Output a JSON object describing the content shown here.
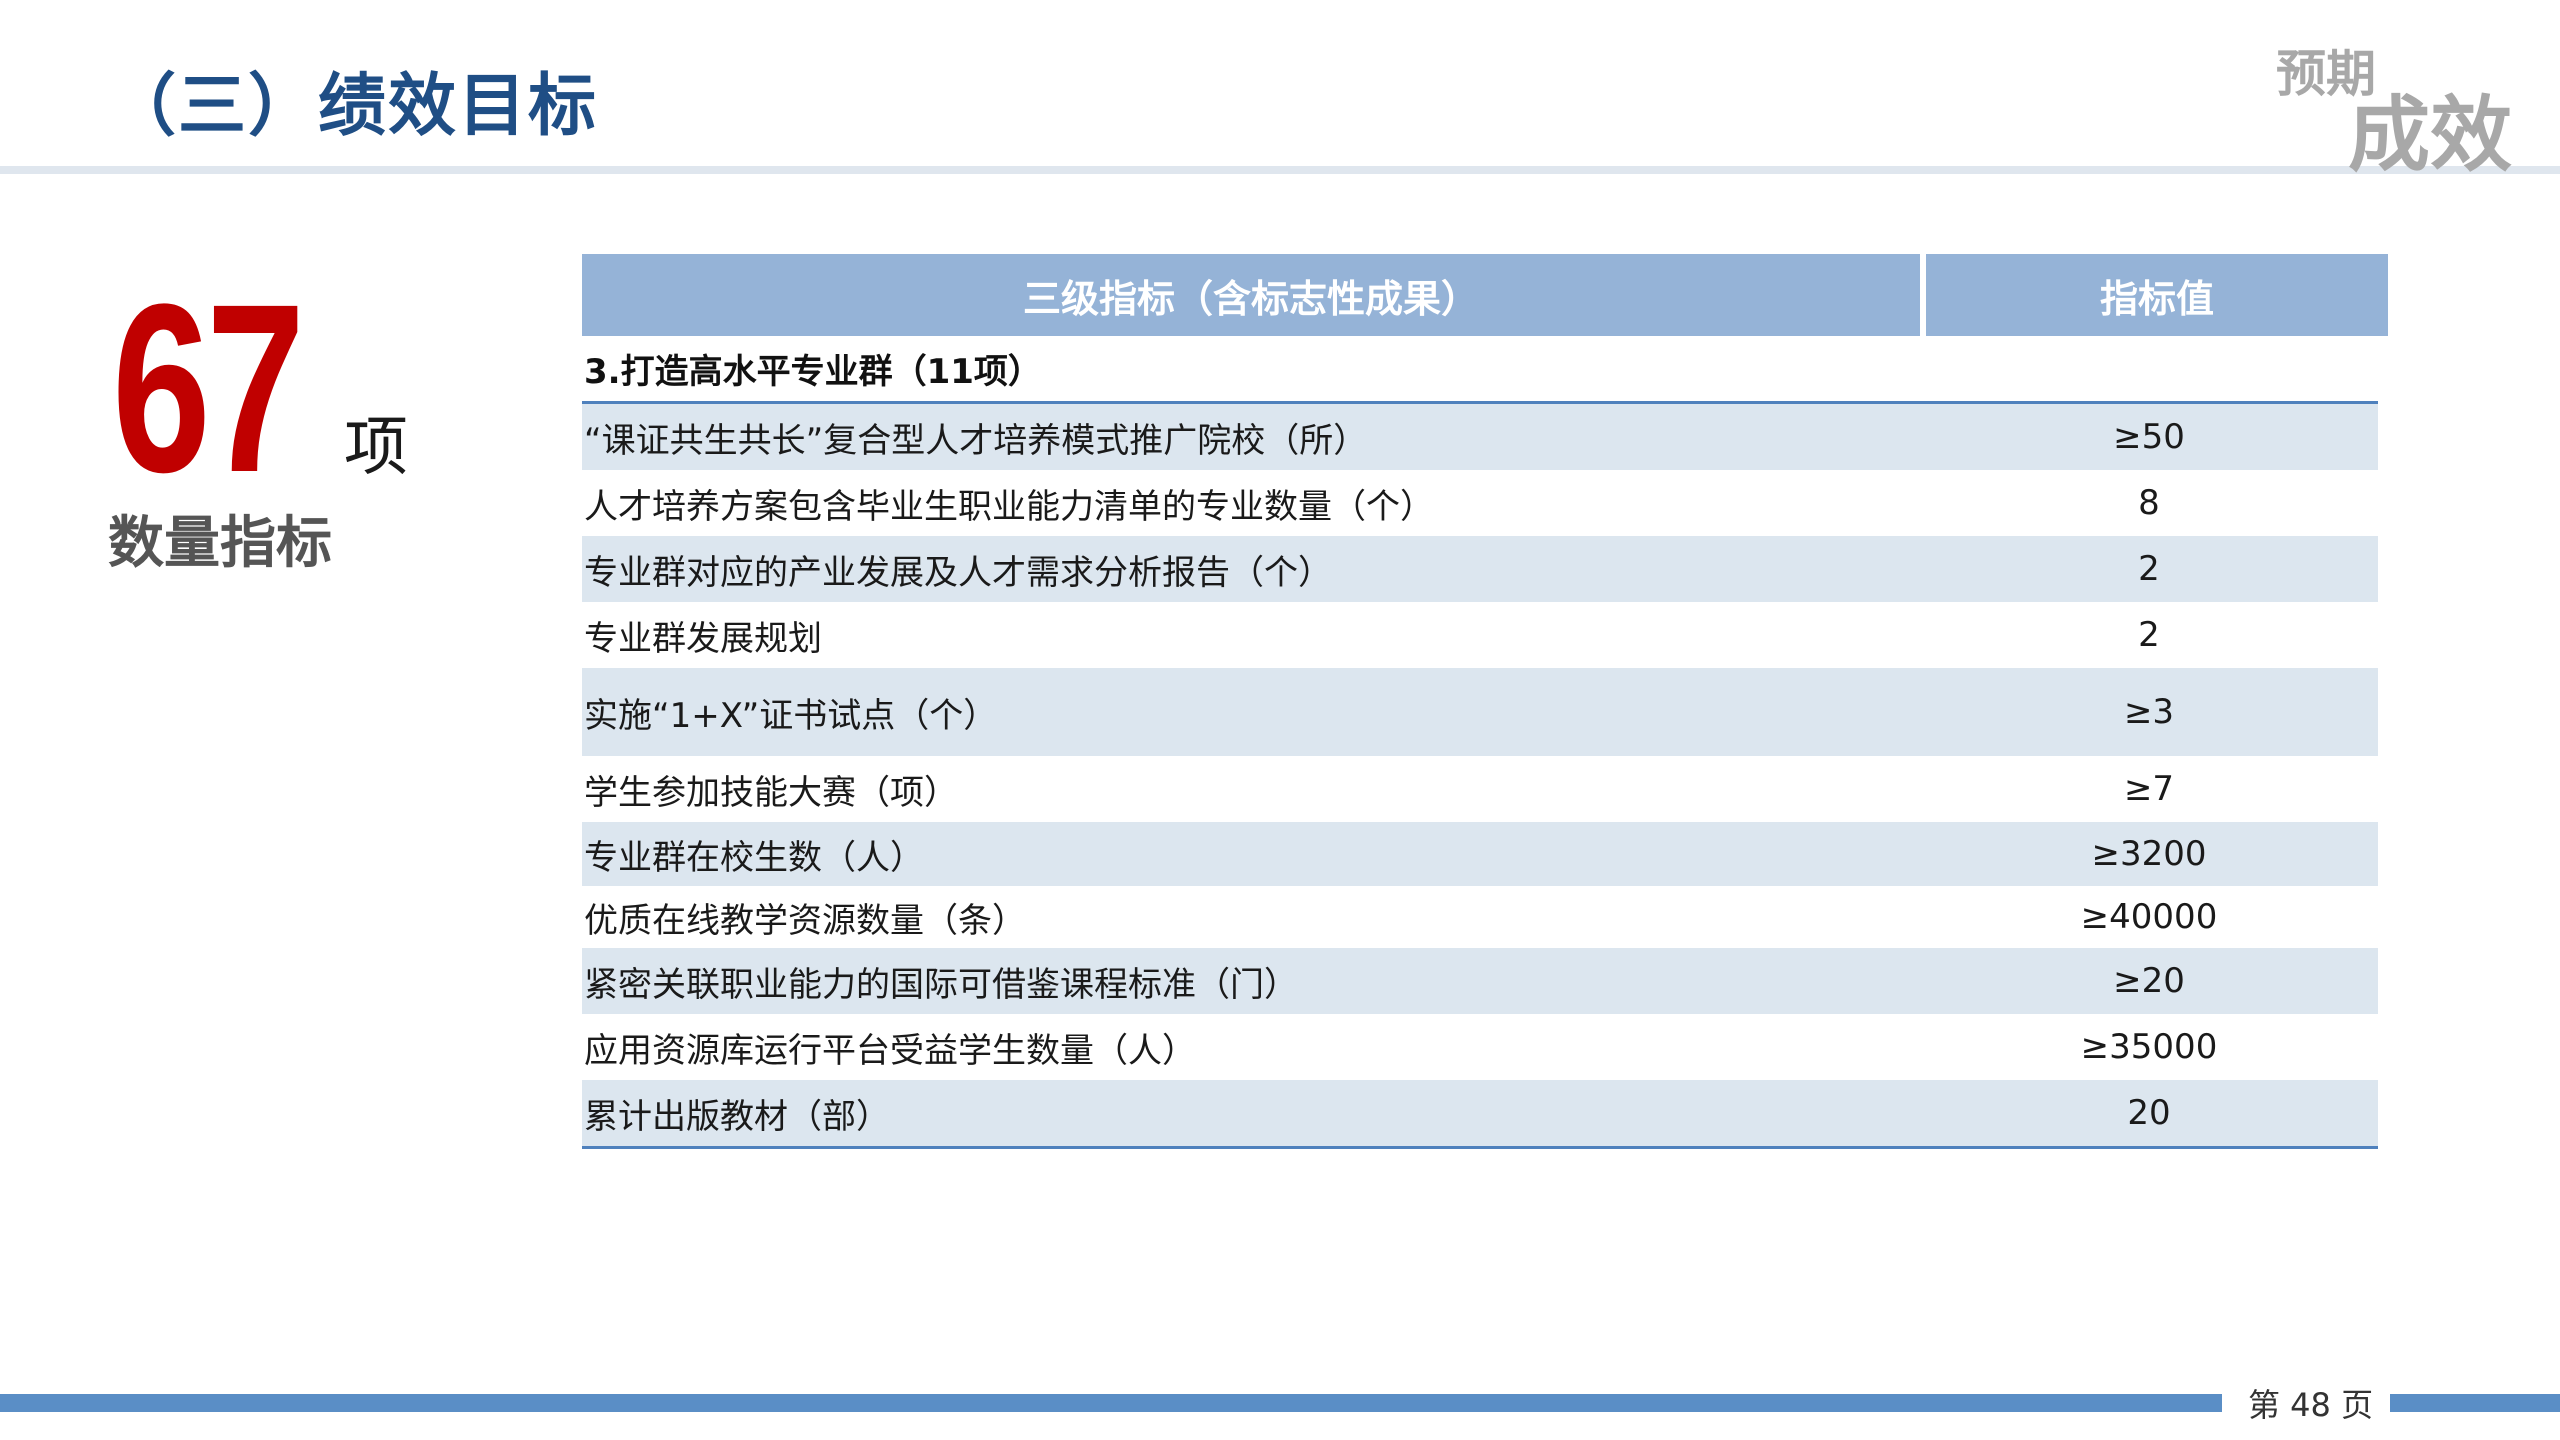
{
  "header": {
    "title": "（三）绩效目标",
    "corner_top": "预期",
    "corner_bottom": "成效"
  },
  "stat": {
    "number": "67",
    "unit": "项",
    "label": "数量指标"
  },
  "table": {
    "columns": [
      "三级指标（含标志性成果）",
      "指标值"
    ],
    "section_title": "3.打造高水平专业群（11项）",
    "rows": [
      {
        "name": "“课证共生共长”复合型人才培养模式推广院校（所）",
        "value": "≥50"
      },
      {
        "name": "人才培养方案包含毕业生职业能力清单的专业数量（个）",
        "value": "8"
      },
      {
        "name": "专业群对应的产业发展及人才需求分析报告（个）",
        "value": "2"
      },
      {
        "name": "专业群发展规划",
        "value": "2"
      },
      {
        "name": "实施“1+X”证书试点（个）",
        "value": "≥3"
      },
      {
        "name": "学生参加技能大赛（项）",
        "value": "≥7"
      },
      {
        "name": "专业群在校生数（人）",
        "value": "≥3200"
      },
      {
        "name": "优质在线教学资源数量（条）",
        "value": "≥40000"
      },
      {
        "name": "紧密关联职业能力的国际可借鉴课程标准（门）",
        "value": "≥20"
      },
      {
        "name": "应用资源库运行平台受益学生数量（人）",
        "value": "≥35000"
      },
      {
        "name": "累计出版教材（部）",
        "value": "20"
      }
    ]
  },
  "footer": {
    "page_label": "第 48 页"
  },
  "colors": {
    "title": "#1f4e85",
    "header_fill": "#95b3d7",
    "row_shade": "#dce6ef",
    "accent_rule": "#4f81bd",
    "stat_red": "#c00000",
    "footer_bar": "#5a8ec6"
  }
}
